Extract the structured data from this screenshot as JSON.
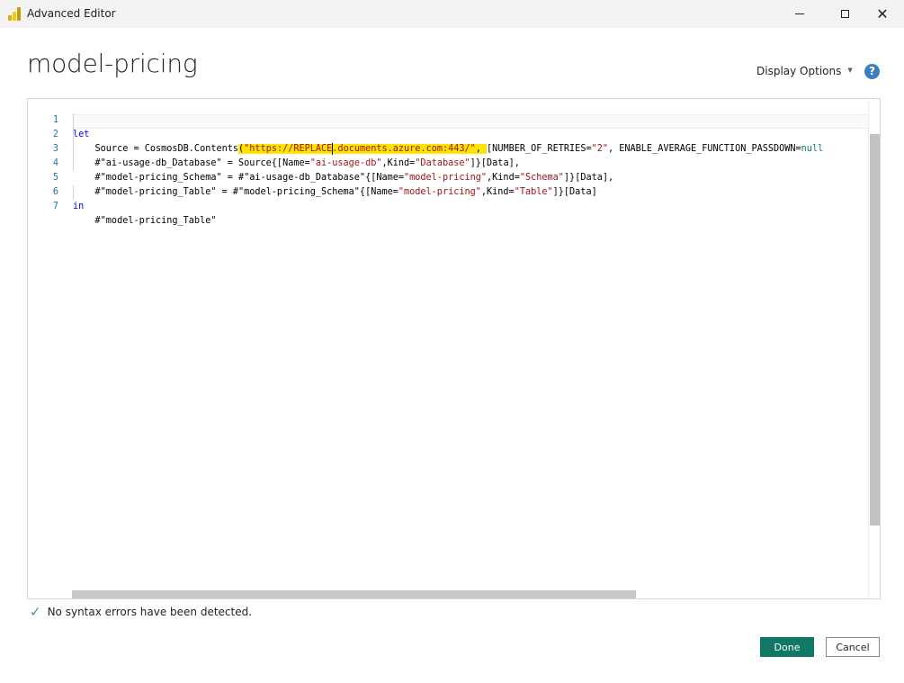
{
  "window": {
    "title": "Advanced Editor"
  },
  "header": {
    "query_name": "model-pricing",
    "display_options_label": "Display Options",
    "help_icon": "?"
  },
  "editor": {
    "line_numbers": [
      "1",
      "2",
      "3",
      "4",
      "5",
      "6",
      "7"
    ],
    "lines": [
      "let",
      "    Source = CosmosDB.Contents(\"https://REPLACE.documents.azure.com:443/\", [NUMBER_OF_RETRIES=\"2\", ENABLE_AVERAGE_FUNCTION_PASSDOWN=null",
      "    #\"ai-usage-db_Database\" = Source{[Name=\"ai-usage-db\",Kind=\"Database\"]}[Data],",
      "    #\"model-pricing_Schema\" = #\"ai-usage-db_Database\"{[Name=\"model-pricing\",Kind=\"Schema\"]}[Data],",
      "    #\"model-pricing_Table\" = #\"model-pricing_Schema\"{[Name=\"model-pricing\",Kind=\"Table\"]}[Data]",
      "in",
      "    #\"model-pricing_Table\""
    ]
  },
  "status": {
    "message": "No syntax errors have been detected."
  },
  "buttons": {
    "done": "Done",
    "cancel": "Cancel"
  },
  "colors": {
    "keyword": "#0000ff",
    "string": "#a31515",
    "line_number": "#237893",
    "highlight": "#ffe500",
    "done_button": "#117865",
    "success_check": "#4b9a5e",
    "help_icon": "#3a7fc1"
  }
}
